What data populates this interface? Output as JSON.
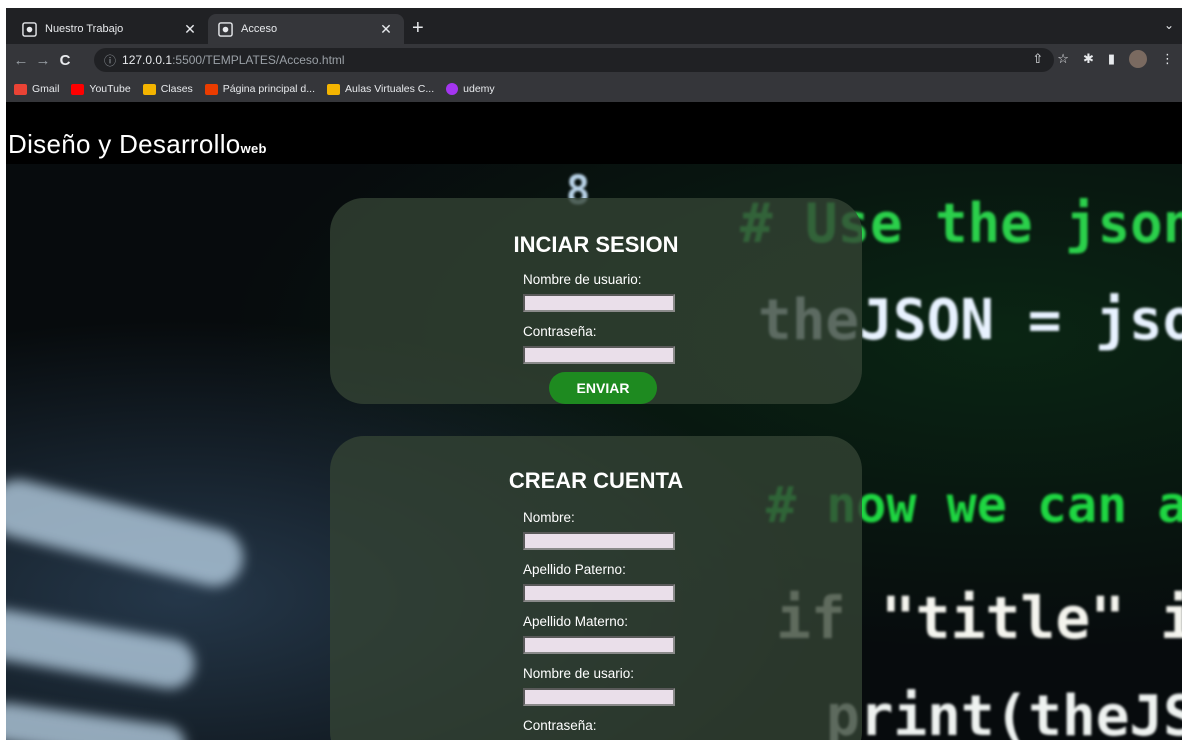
{
  "browser": {
    "tabs": [
      {
        "title": "Nuestro Trabajo",
        "active": false
      },
      {
        "title": "Acceso",
        "active": true
      }
    ],
    "url_host": "127.0.0.1",
    "url_path": ":5500/TEMPLATES/Acceso.html",
    "bookmarks": [
      {
        "label": "Gmail",
        "icon": "gmail-icon",
        "color": "#ea4335"
      },
      {
        "label": "YouTube",
        "icon": "youtube-icon",
        "color": "#ff0000"
      },
      {
        "label": "Clases",
        "icon": "classroom-icon",
        "color": "#f4b400"
      },
      {
        "label": "Página principal d...",
        "icon": "office-icon",
        "color": "#eb3c00"
      },
      {
        "label": "Aulas Virtuales C...",
        "icon": "aulas-icon",
        "color": "#f4b400"
      },
      {
        "label": "udemy",
        "icon": "udemy-icon",
        "color": "#a435f0"
      }
    ]
  },
  "site": {
    "brand": "Diseño y Desarrollo",
    "brand_suffix": "web"
  },
  "login": {
    "title": "INCIAR SESION",
    "username_label": "Nombre de usuario:",
    "password_label": "Contraseña:",
    "submit_label": "ENVIAR"
  },
  "register": {
    "title": "CREAR CUENTA",
    "fields": [
      {
        "label": "Nombre:"
      },
      {
        "label": "Apellido Paterno:"
      },
      {
        "label": "Apellido Materno:"
      },
      {
        "label": "Nombre de usario:"
      },
      {
        "label": "Contraseña:"
      }
    ]
  },
  "background_code": {
    "line1": "# Use the json",
    "line2": "theJSON = json.",
    "line3": "# now we can a",
    "line4": "if \"title\" in",
    "line5": "print(theJSO"
  },
  "colors": {
    "card_bg": "#344434",
    "button": "#1e8a20",
    "input_bg": "#eadfea"
  }
}
